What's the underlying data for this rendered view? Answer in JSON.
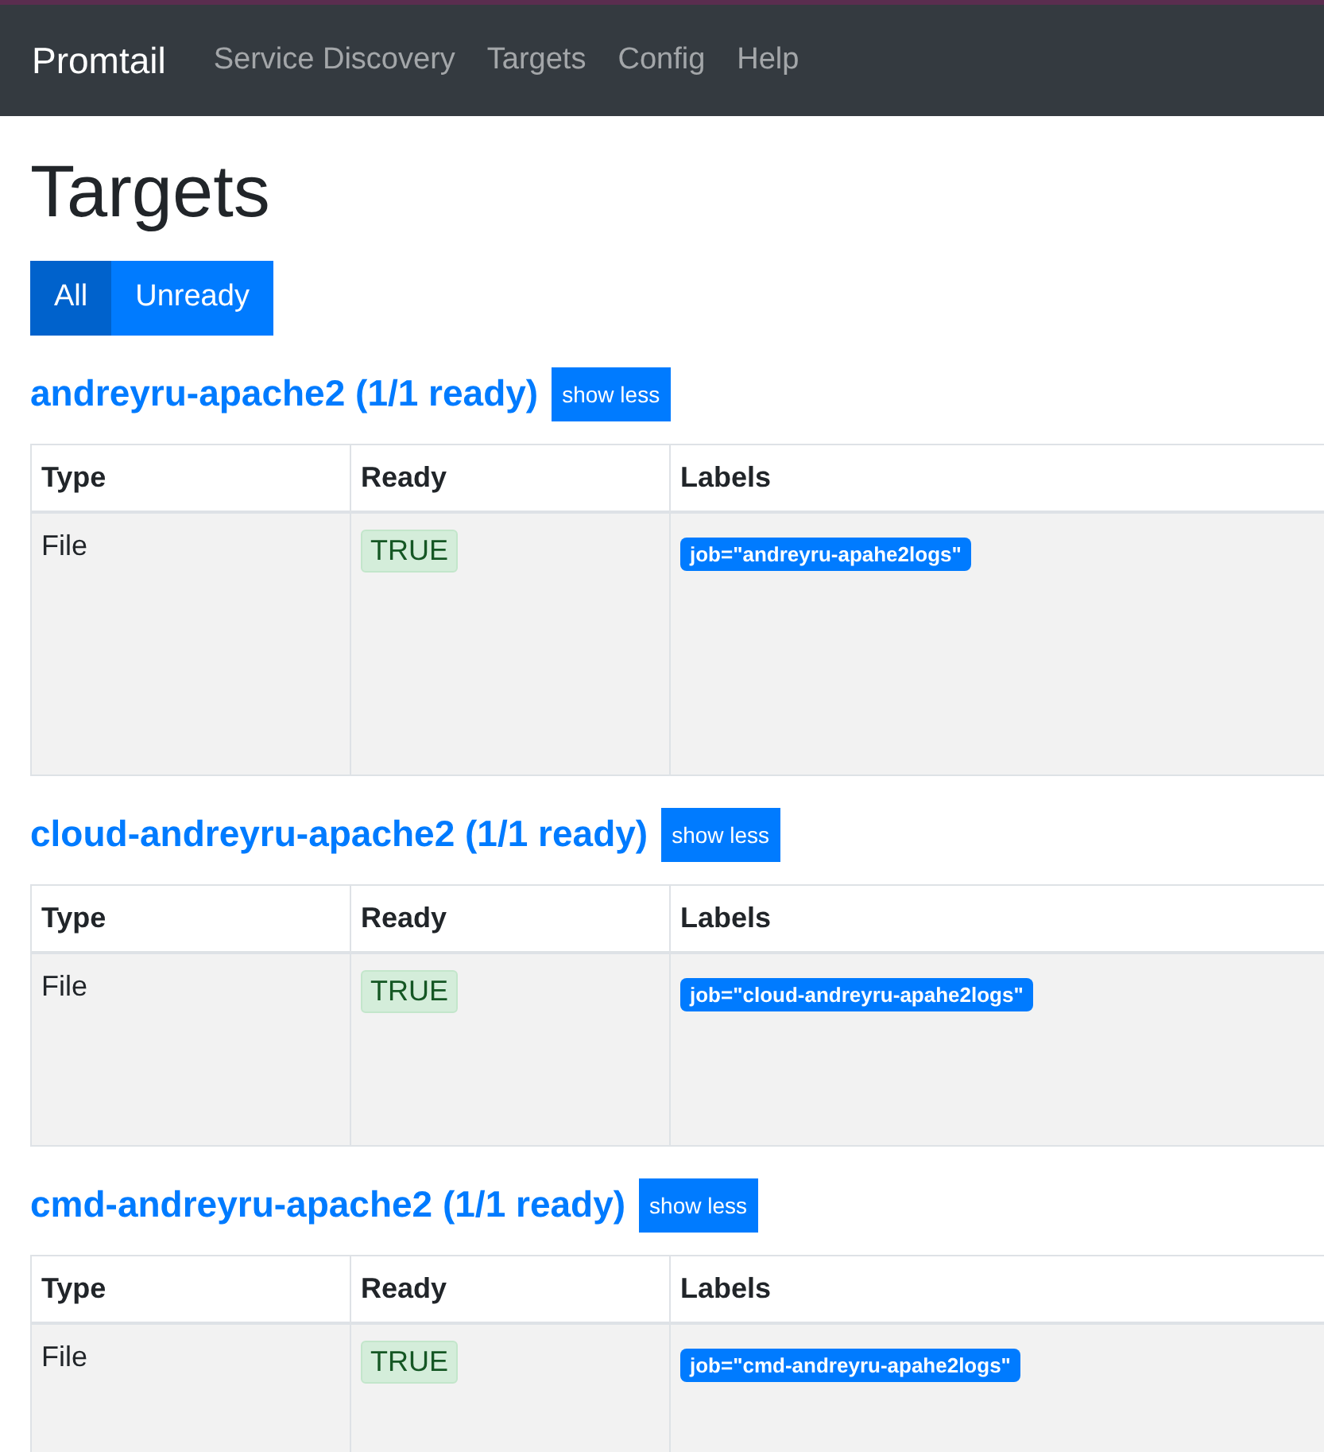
{
  "navbar": {
    "brand": "Promtail",
    "links": [
      {
        "label": "Service Discovery",
        "selected": false
      },
      {
        "label": "Targets",
        "selected": false
      },
      {
        "label": "Config",
        "selected": false
      },
      {
        "label": "Help",
        "selected": false
      }
    ]
  },
  "page_title": "Targets",
  "filters": [
    {
      "label": "All",
      "selected": true
    },
    {
      "label": "Unready",
      "selected": false
    }
  ],
  "pools": [
    {
      "title": "andreyru-apache2 (1/1 ready)",
      "toggle": "show less",
      "columns": [
        "Type",
        "Ready",
        "Labels"
      ],
      "rows": [
        {
          "type": "File",
          "ready": "TRUE",
          "labels": [
            "job=\"andreyru-apahe2logs\""
          ]
        }
      ]
    },
    {
      "title": "cloud-andreyru-apache2 (1/1 ready)",
      "toggle": "show less",
      "columns": [
        "Type",
        "Ready",
        "Labels"
      ],
      "rows": [
        {
          "type": "File",
          "ready": "TRUE",
          "labels": [
            "job=\"cloud-andreyru-apahe2logs\""
          ]
        }
      ]
    },
    {
      "title": "cmd-andreyru-apache2 (1/1 ready)",
      "toggle": "show less",
      "columns": [
        "Type",
        "Ready",
        "Labels"
      ],
      "rows": [
        {
          "type": "File",
          "ready": "TRUE",
          "labels": [
            "job=\"cmd-andreyru-apahe2logs\""
          ]
        }
      ]
    }
  ]
}
